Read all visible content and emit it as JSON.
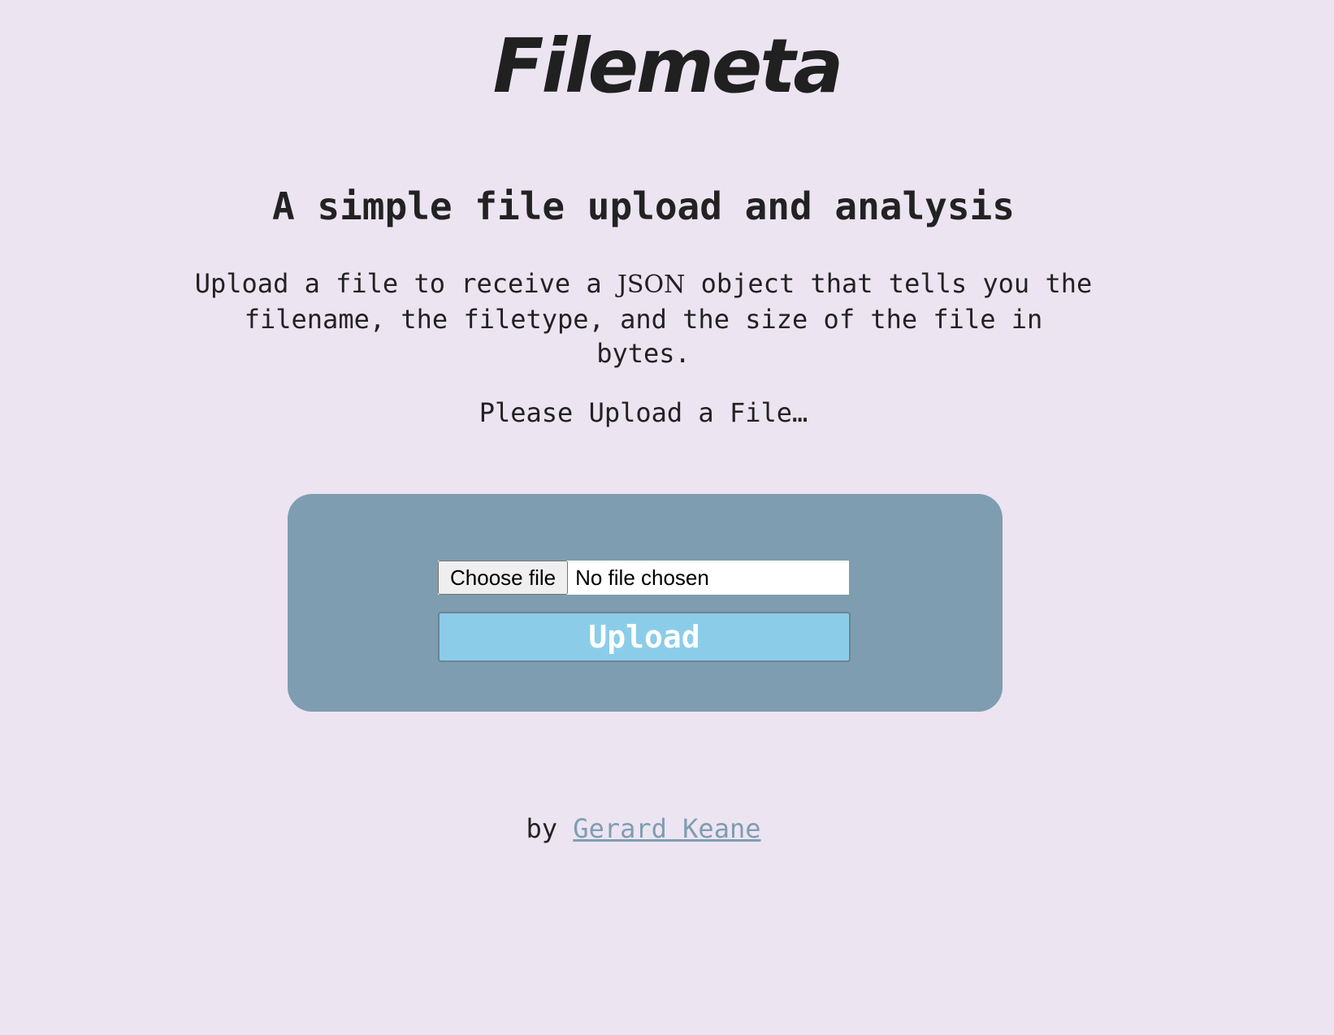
{
  "header": {
    "logo_text": "Filemeta"
  },
  "intro": {
    "headline": "A simple file upload and analysis",
    "description_before": "Upload a file to receive a ",
    "description_code": "JSON",
    "description_after": " object that tells you the filename, the filetype, and the size of the file in bytes.",
    "prompt": "Please Upload a File…"
  },
  "upload_form": {
    "choose_file_label": "Choose file",
    "file_status": "No file chosen",
    "upload_label": "Upload"
  },
  "footer": {
    "by_text": "by",
    "author_name": "Gerard Keane"
  },
  "colors": {
    "page_background": "#ece4f1",
    "panel_background": "#7f9db0",
    "upload_button": "#8bcde8",
    "link": "#7f9db0",
    "text": "#222222"
  }
}
